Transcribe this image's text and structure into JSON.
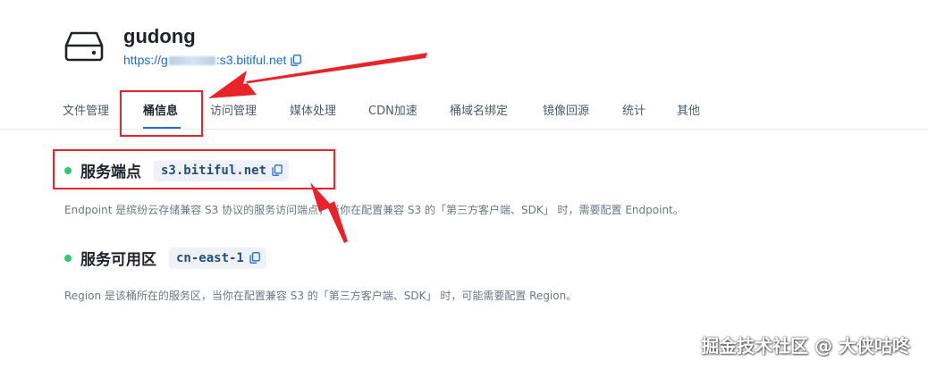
{
  "header": {
    "icon": "hard-drive-icon",
    "title": "gudong",
    "url_prefix": "https://g",
    "url_suffix": ":s3.bitiful.net",
    "copy_icon": "copy-icon"
  },
  "tabs": [
    {
      "label": "文件管理",
      "active": false
    },
    {
      "label": "桶信息",
      "active": true
    },
    {
      "label": "访问管理",
      "active": false
    },
    {
      "label": "媒体处理",
      "active": false
    },
    {
      "label": "CDN加速",
      "active": false
    },
    {
      "label": "桶域名绑定",
      "active": false
    },
    {
      "label": "镜像回源",
      "active": false
    },
    {
      "label": "统计",
      "active": false
    },
    {
      "label": "其他",
      "active": false
    }
  ],
  "endpoint": {
    "title": "服务端点",
    "value": "s3.bitiful.net",
    "description": "Endpoint 是缤纷云存储兼容 S3 协议的服务访问端点，当你在配置兼容 S3 的「第三方客户端、SDK」 时，需要配置 Endpoint。"
  },
  "region": {
    "title": "服务可用区",
    "value": "cn-east-1",
    "description": "Region 是该桶所在的服务区，当你在配置兼容 S3 的「第三方客户端、SDK」 时，可能需要配置 Region。"
  },
  "watermark": "掘金技术社区 @ 大侠咕咚",
  "colors": {
    "accent": "#1a6fd1",
    "status_dot": "#2ecc71",
    "annotation": "#e8242a"
  }
}
